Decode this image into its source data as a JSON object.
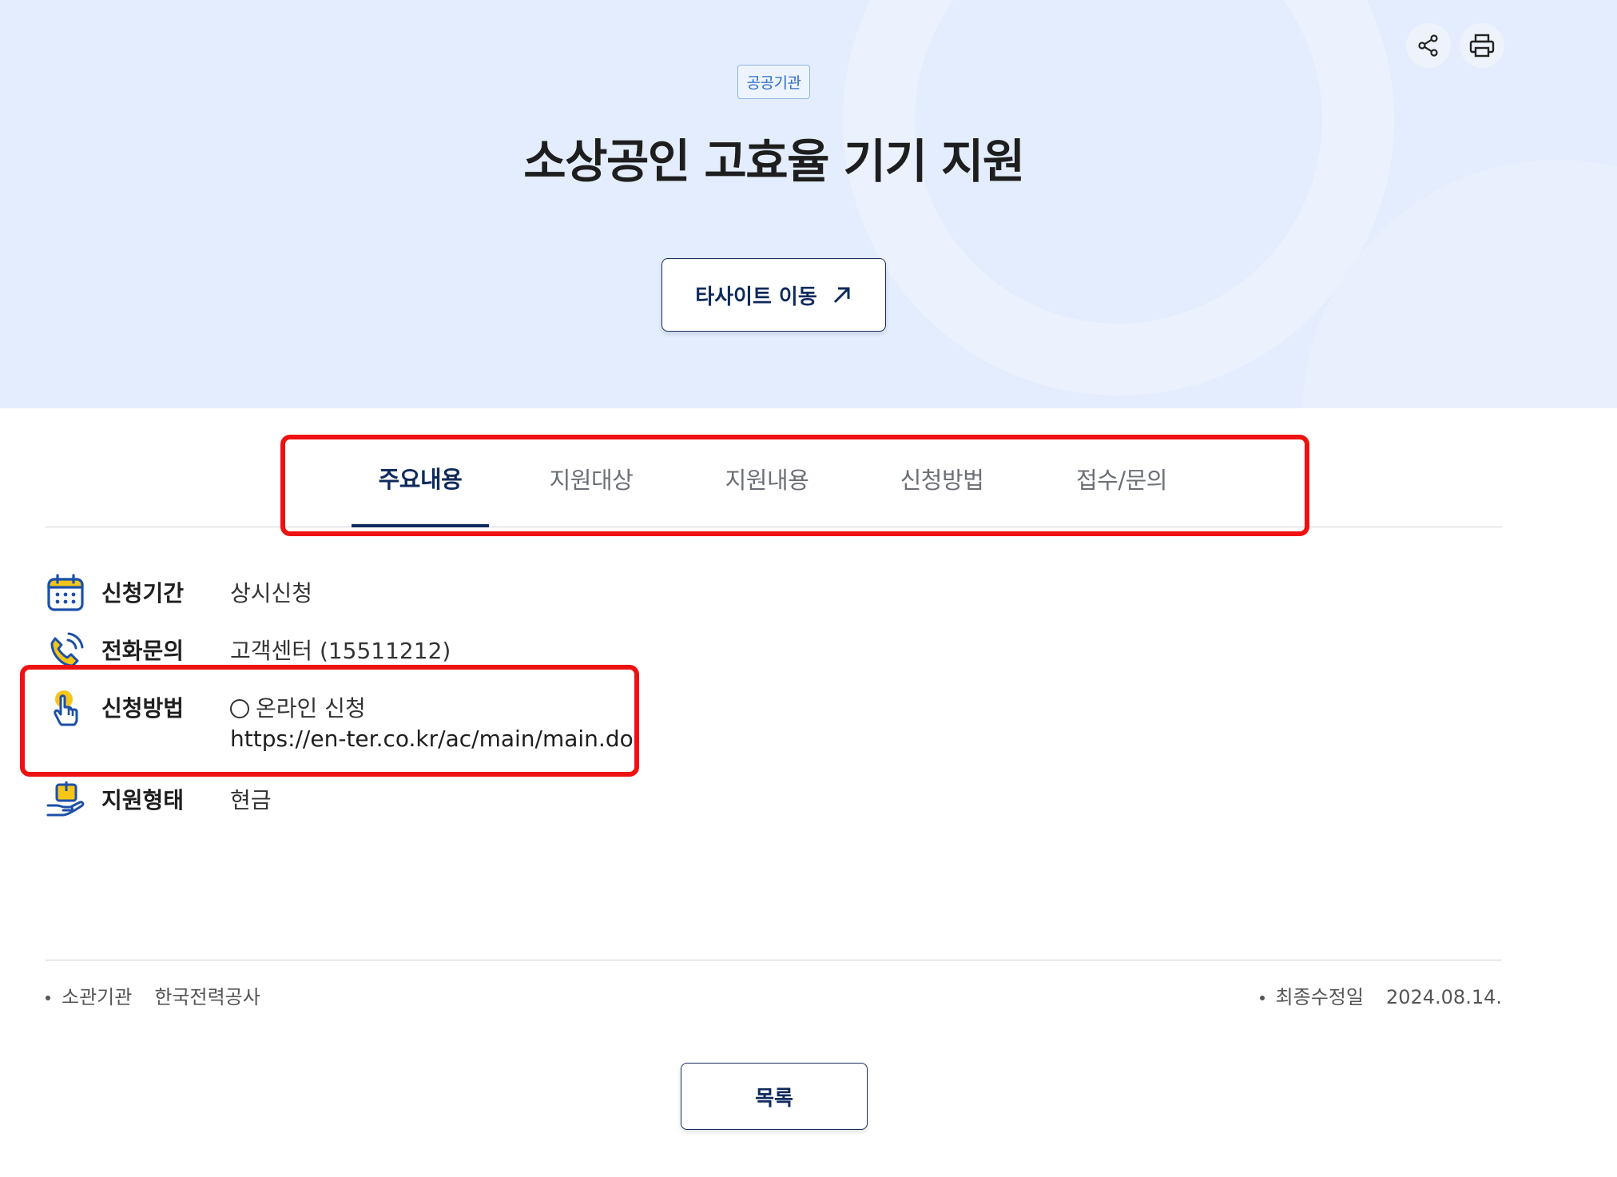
{
  "header": {
    "org_badge": "공공기관",
    "title": "소상공인 고효율 기기 지원",
    "site_button_label": "타사이트 이동",
    "share_icon": "share-icon",
    "print_icon": "print-icon"
  },
  "tabs": [
    {
      "label": "주요내용",
      "active": true
    },
    {
      "label": "지원대상",
      "active": false
    },
    {
      "label": "지원내용",
      "active": false
    },
    {
      "label": "신청방법",
      "active": false
    },
    {
      "label": "접수/문의",
      "active": false
    }
  ],
  "info": [
    {
      "icon": "calendar-icon",
      "label": "신청기간",
      "value": "상시신청"
    },
    {
      "icon": "phone-icon",
      "label": "전화문의",
      "value": "고객센터 (15511212)"
    },
    {
      "icon": "hand-pointer-icon",
      "label": "신청방법",
      "value": "온라인 신청",
      "link": "https://en-ter.co.kr/ac/main/main.do"
    },
    {
      "icon": "hand-coin-icon",
      "label": "지원형태",
      "value": "현금"
    }
  ],
  "footer": {
    "agency_label": "소관기관",
    "agency_value": "한국전력공사",
    "updated_label": "최종수정일",
    "updated_value": "2024.08.14."
  },
  "list_button_label": "목록",
  "colors": {
    "hero_bg": "#e3edfd",
    "navy": "#0f2a5c",
    "highlight": "#ee1111",
    "icon_yellow": "#f5c518",
    "icon_blue": "#1e4fa8"
  }
}
